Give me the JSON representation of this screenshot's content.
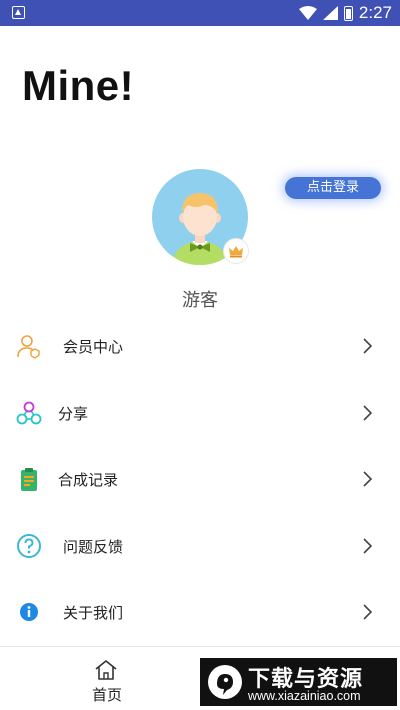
{
  "status_bar": {
    "time": "2:27"
  },
  "page": {
    "title": "Mine!"
  },
  "profile": {
    "login_label": "点击登录",
    "username": "游客"
  },
  "menu": [
    {
      "label": "会员中心",
      "icon": "member-icon"
    },
    {
      "label": "分享",
      "icon": "share-icon"
    },
    {
      "label": "合成记录",
      "icon": "record-icon"
    },
    {
      "label": "问题反馈",
      "icon": "feedback-icon"
    },
    {
      "label": "关于我们",
      "icon": "info-icon"
    }
  ],
  "bottom_nav": {
    "home_label": "首页"
  },
  "watermark": {
    "title": "下载与资源",
    "url": "www.xiazainiao.com"
  },
  "colors": {
    "status_bar": "#3f51b5",
    "login_button": "#4574d6",
    "avatar_bg": "#8fd0ee"
  }
}
